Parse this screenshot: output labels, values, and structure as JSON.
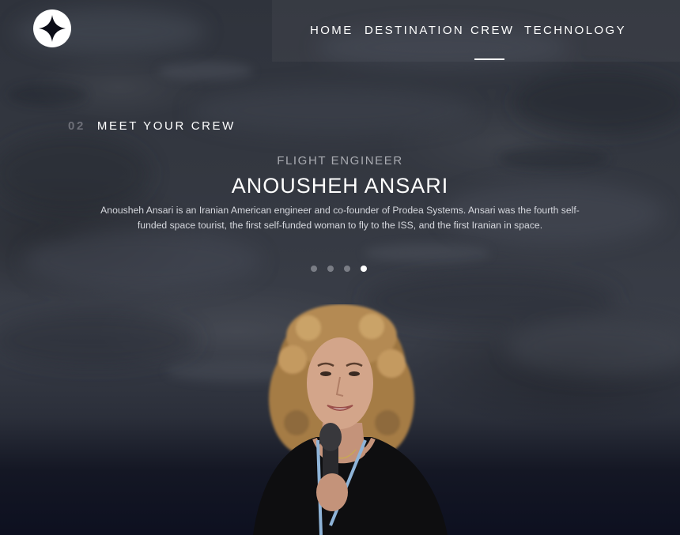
{
  "nav": {
    "items": [
      {
        "label": "HOME"
      },
      {
        "label": "DESTINATION"
      },
      {
        "label": "CREW"
      },
      {
        "label": "TECHNOLOGY"
      }
    ],
    "active": "CREW"
  },
  "page_heading": {
    "number": "02",
    "title": "MEET YOUR CREW"
  },
  "crew_member": {
    "role": "FLIGHT ENGINEER",
    "name": "ANOUSHEH ANSARI",
    "bio": "Anousheh Ansari is an Iranian American engineer and co-founder of Prodea Systems. Ansari was the fourth self-funded space tourist, the first self-funded woman to fly to the ISS, and the first Iranian in space."
  },
  "carousel": {
    "total": 4,
    "active_index": 3
  },
  "colors": {
    "background": "#343841",
    "text": "#ffffff",
    "muted": "#a9abb1",
    "dot_inactive": "#7a7d85"
  },
  "icons": {
    "logo": "four-point-star-logo-icon"
  }
}
